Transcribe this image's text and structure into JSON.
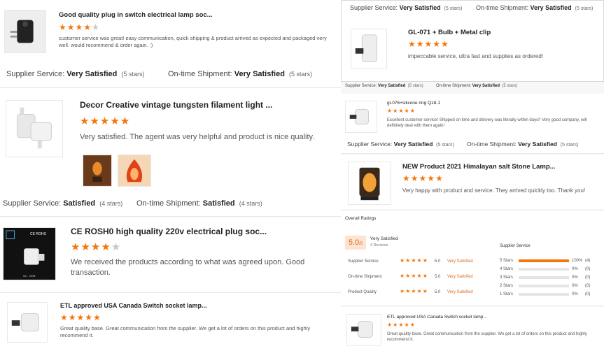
{
  "left_reviews": [
    {
      "title": "Good quality plug in switch electrical lamp soc...",
      "stars": 4,
      "comment": "customer service was great! easy communication, quick shipping & product arrived as expected and packaged very well. would recommend & order again. :)",
      "supplier_label": "Supplier Service:",
      "supplier_value": "Very Satisfied",
      "supplier_count": "(5 stars)",
      "shipment_label": "On-time Shipment:",
      "shipment_value": "Very Satisfied",
      "shipment_count": "(5 stars)"
    },
    {
      "title": "Decor Creative vintage tungsten filament light ...",
      "stars": 5,
      "comment": "Very satisfied. The agent was very helpful and product is nice quality.",
      "supplier_label": "Supplier Service:",
      "supplier_value": "Satisfied",
      "supplier_count": "(4 stars)",
      "shipment_label": "On-time Shipment:",
      "shipment_value": "Satisfied",
      "shipment_count": "(4 stars)"
    },
    {
      "title": "CE ROSH0 high quality 220v electrical plug soc...",
      "stars": 4,
      "comment": "We received the products according to what was agreed upon. Good transaction.",
      "thumb_text": "CE ROHS",
      "thumb_code": "GL - GRB"
    },
    {
      "title": "ETL approved USA Canada Switch socket lamp...",
      "stars": 5,
      "comment": "Great quality base. Great communication from the supplier. We get a lot of orders on this product and highly recommend it."
    }
  ],
  "right_top": {
    "supplier_label": "Supplier Service:",
    "supplier_value": "Very Satisfied",
    "supplier_count": "(5 stars)",
    "shipment_label": "On-time Shipment:",
    "shipment_value": "Very Satisfied",
    "shipment_count": "(5 stars)"
  },
  "right_reviews": [
    {
      "title": "GL-071 + Bulb + Metal clip",
      "stars": 5,
      "comment": "impeccable service, ultra fast and supplies as ordered!",
      "supplier_label": "Supplier Service:",
      "supplier_value": "Very Satisfied",
      "supplier_count": "(5 stars)",
      "shipment_label": "On-time Shipment:",
      "shipment_value": "Very Satisfied",
      "shipment_count": "(5 stars)"
    },
    {
      "title": "gl-076+silicone ring Q18-1",
      "stars": 5,
      "comment": "Excellent customer service! Shipped on time and delivery was literally within days!! Very good company, will definitely deal with them again!",
      "supplier_label": "Supplier Service:",
      "supplier_value": "Very Satisfied",
      "supplier_count": "(5 stars)",
      "shipment_label": "On-time Shipment:",
      "shipment_value": "Very Satisfied",
      "shipment_count": "(5 stars)"
    },
    {
      "title": "NEW Product 2021 Himalayan salt Stone Lamp...",
      "stars": 5,
      "comment": "Very happy with product and service. They arrived quickly too. Thank you!"
    },
    {
      "title": "ETL approved USA Canada Switch socket lamp...",
      "stars": 5,
      "comment": "Great quality base. Great communication from the supplier. We get a lot of orders on this product and highly recommend it."
    }
  ],
  "overall": {
    "heading": "Overall Ratings",
    "score": "5.0",
    "score_suffix": "/5",
    "label": "Very Satisfied",
    "reviews": "4 Reviews",
    "rows": [
      {
        "label": "Supplier Service",
        "stars": 5,
        "value": "5.0",
        "text": "Very Satisfied"
      },
      {
        "label": "On-time Shipment",
        "stars": 5,
        "value": "5.0",
        "text": "Very Satisfied"
      },
      {
        "label": "Product Quality",
        "stars": 5,
        "value": "5.0",
        "text": "Very Satisfied"
      }
    ],
    "breakdown_title": "Supplier Service",
    "breakdown": [
      {
        "label": "5 Stars",
        "fraction": 1.0,
        "pct": "100%",
        "count": "(4)"
      },
      {
        "label": "4 Stars",
        "fraction": 0,
        "pct": "0%",
        "count": "(0)"
      },
      {
        "label": "3 Stars",
        "fraction": 0,
        "pct": "0%",
        "count": "(0)"
      },
      {
        "label": "2 Stars",
        "fraction": 0,
        "pct": "0%",
        "count": "(0)"
      },
      {
        "label": "1 Stars",
        "fraction": 0,
        "pct": "0%",
        "count": "(0)"
      }
    ]
  },
  "colors": {
    "accent": "#f5760a",
    "star_off": "#c8c8c8"
  }
}
